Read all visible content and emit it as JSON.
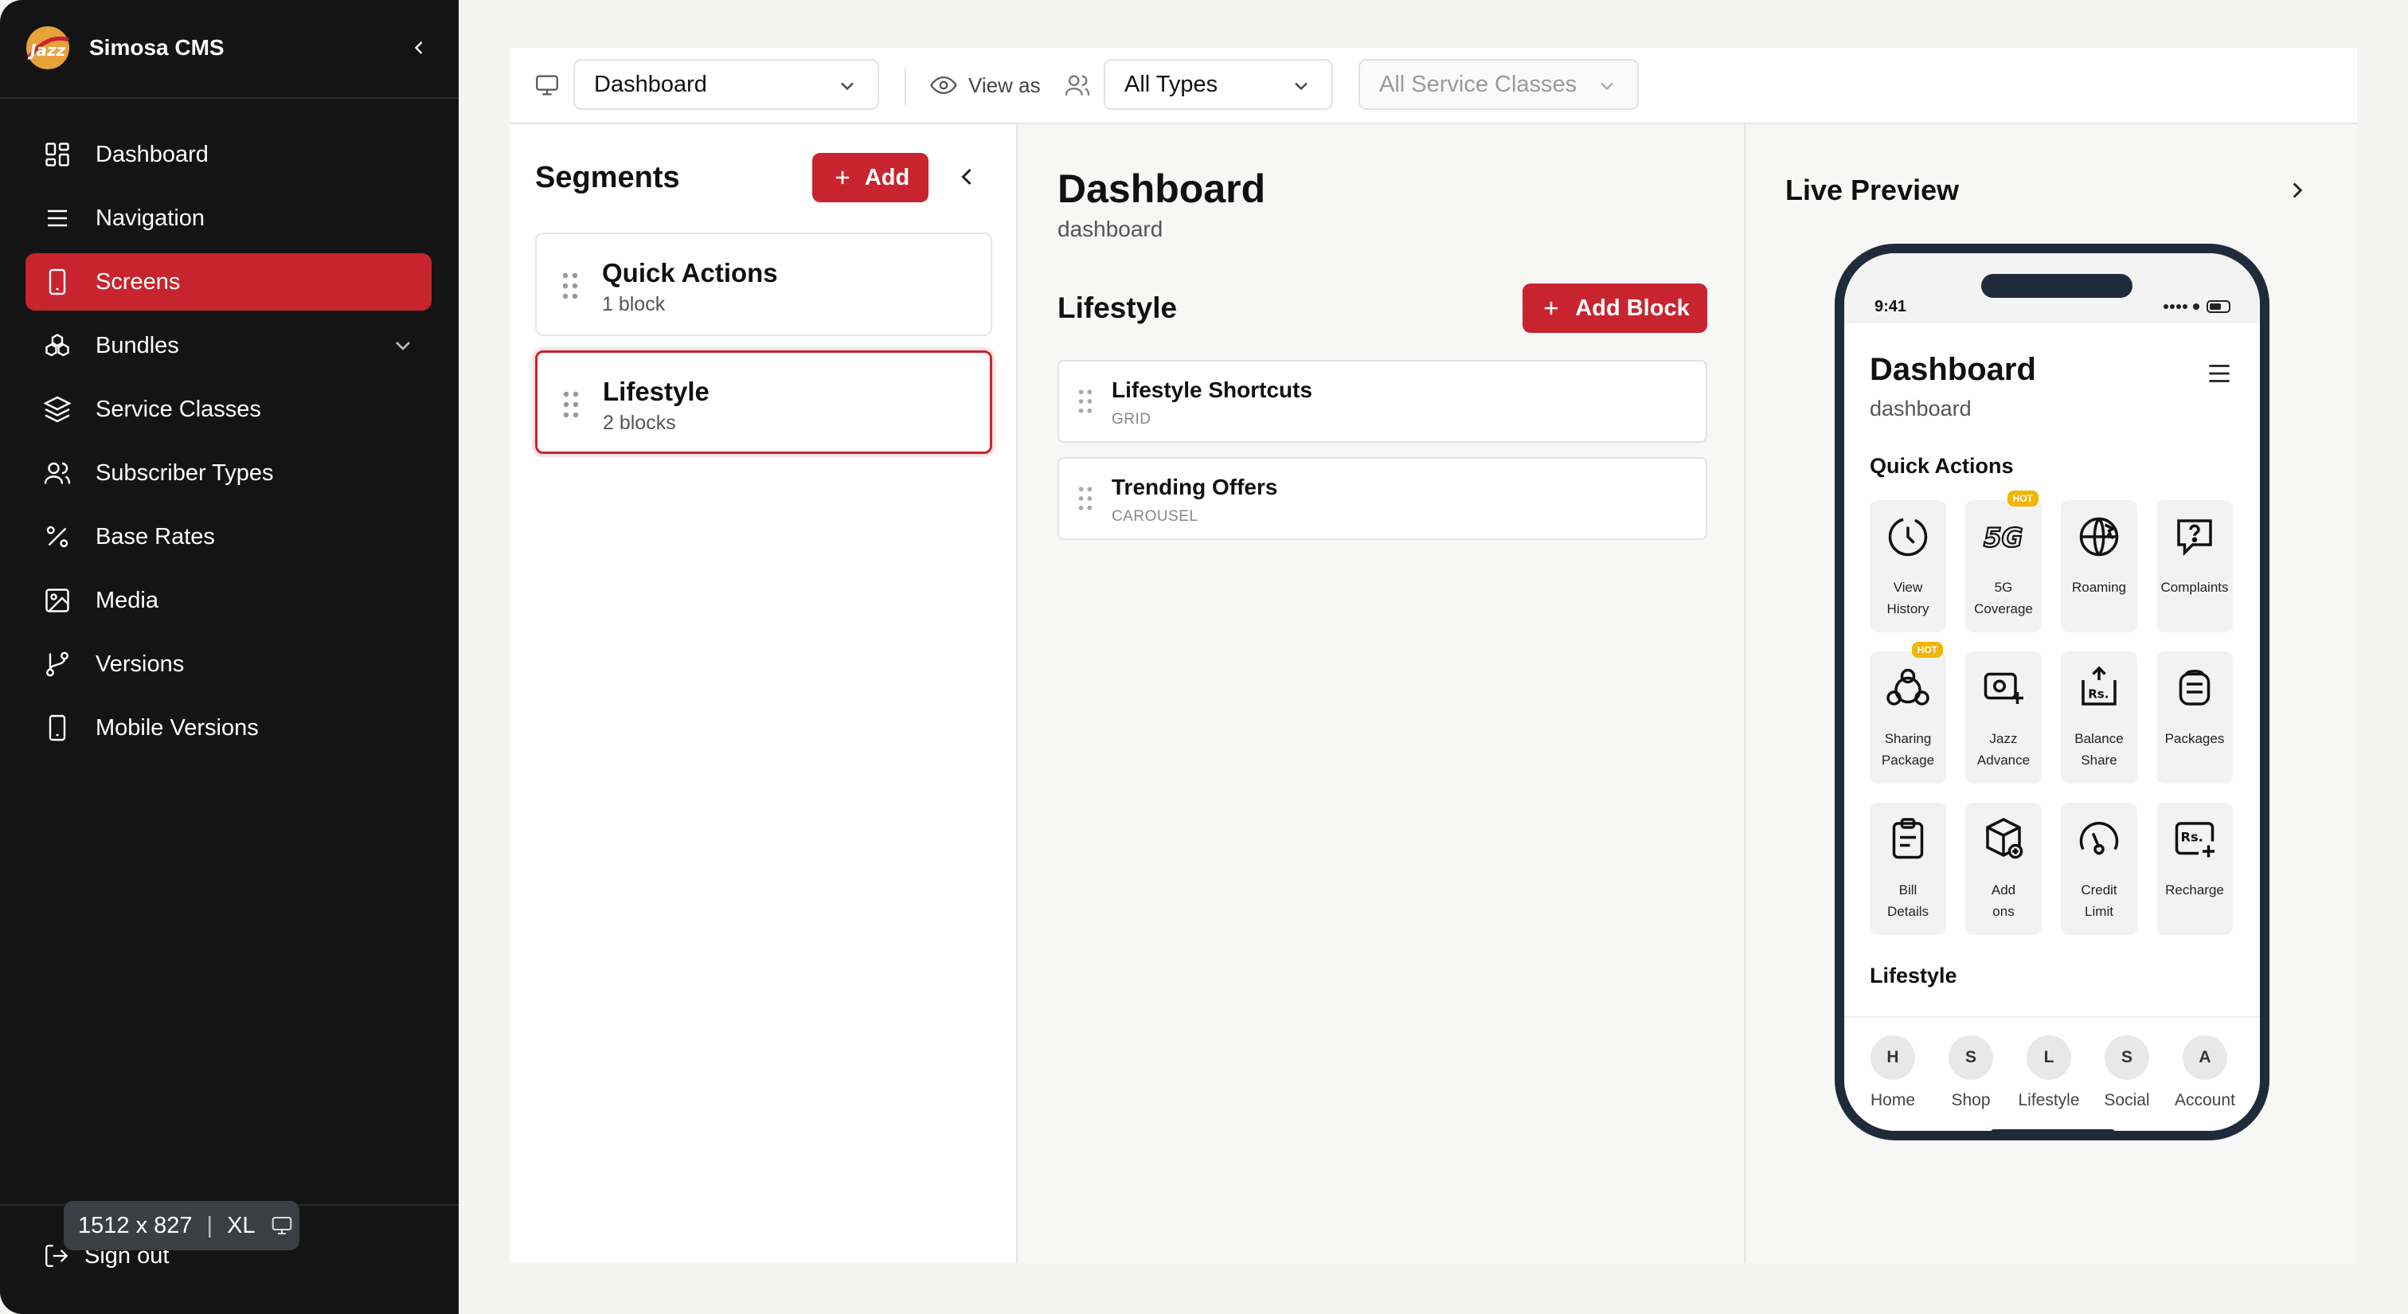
{
  "sidebar": {
    "app_name": "Simosa CMS",
    "items": [
      {
        "label": "Dashboard",
        "icon": "dashboard-icon"
      },
      {
        "label": "Navigation",
        "icon": "menu-icon"
      },
      {
        "label": "Screens",
        "icon": "smartphone-icon",
        "active": true
      },
      {
        "label": "Bundles",
        "icon": "bundles-icon",
        "expandable": true
      },
      {
        "label": "Service Classes",
        "icon": "layers-icon"
      },
      {
        "label": "Subscriber Types",
        "icon": "users-icon"
      },
      {
        "label": "Base Rates",
        "icon": "percent-icon"
      },
      {
        "label": "Media",
        "icon": "image-icon"
      },
      {
        "label": "Versions",
        "icon": "git-branch-icon"
      },
      {
        "label": "Mobile Versions",
        "icon": "smartphone-icon"
      }
    ],
    "sign_out": "Sign out",
    "viewport": {
      "size": "1512 x 827",
      "breakpoint": "XL"
    }
  },
  "topbar": {
    "screen_select": "Dashboard",
    "view_as": "View as",
    "type_select": "All Types",
    "service_class_select": "All Service Classes"
  },
  "segments": {
    "title": "Segments",
    "add_label": "Add",
    "items": [
      {
        "name": "Quick Actions",
        "count": "1 block"
      },
      {
        "name": "Lifestyle",
        "count": "2 blocks",
        "active": true
      }
    ]
  },
  "screen": {
    "title": "Dashboard",
    "slug": "dashboard",
    "segment_title": "Lifestyle",
    "add_block_label": "Add Block",
    "blocks": [
      {
        "name": "Lifestyle Shortcuts",
        "type": "GRID"
      },
      {
        "name": "Trending Offers",
        "type": "CAROUSEL"
      }
    ]
  },
  "preview": {
    "title": "Live Preview",
    "phone": {
      "time": "9:41",
      "title": "Dashboard",
      "subtitle": "dashboard",
      "section1": "Quick Actions",
      "section2": "Lifestyle",
      "hot_label": "HOT",
      "tiles": [
        {
          "label1": "View",
          "label2": "History",
          "icon": "history-icon"
        },
        {
          "label1": "5G",
          "label2": "Coverage",
          "icon": "5g-icon",
          "hot": true
        },
        {
          "label1": "Roaming",
          "label2": "",
          "icon": "globe-plane-icon"
        },
        {
          "label1": "Complaints",
          "label2": "",
          "icon": "help-bubble-icon"
        },
        {
          "label1": "Sharing",
          "label2": "Package",
          "icon": "share-icon",
          "hot": true
        },
        {
          "label1": "Jazz",
          "label2": "Advance",
          "icon": "money-plus-icon"
        },
        {
          "label1": "Balance",
          "label2": "Share",
          "icon": "rs-upload-icon"
        },
        {
          "label1": "Packages",
          "label2": "",
          "icon": "package-icon"
        },
        {
          "label1": "Bill",
          "label2": "Details",
          "icon": "clipboard-icon"
        },
        {
          "label1": "Add",
          "label2": "ons",
          "icon": "box-plus-icon"
        },
        {
          "label1": "Credit",
          "label2": "Limit",
          "icon": "gauge-icon"
        },
        {
          "label1": "Recharge",
          "label2": "",
          "icon": "rs-plus-icon"
        }
      ],
      "tabs": [
        {
          "initial": "H",
          "label": "Home"
        },
        {
          "initial": "S",
          "label": "Shop"
        },
        {
          "initial": "L",
          "label": "Lifestyle"
        },
        {
          "initial": "S",
          "label": "Social"
        },
        {
          "initial": "A",
          "label": "Account"
        }
      ]
    }
  },
  "colors": {
    "accent": "#c8242f",
    "sidebar_bg": "#141414",
    "hot_badge": "#f4b400",
    "phone_frame": "#1f2b3a"
  }
}
